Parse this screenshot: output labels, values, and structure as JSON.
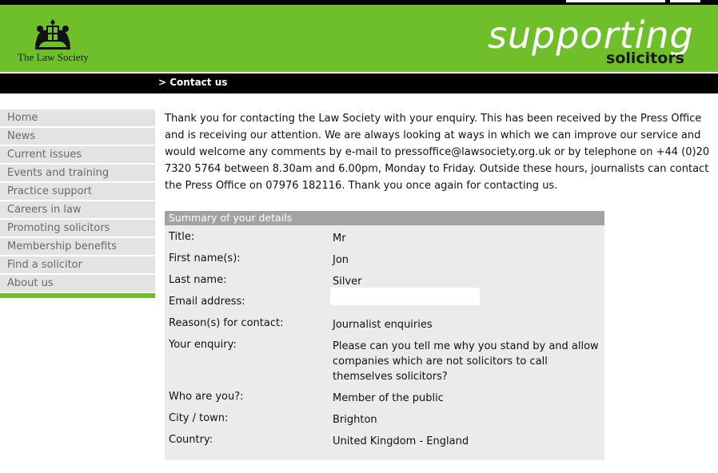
{
  "header": {
    "logo_text": "The Law Society",
    "slogan_top": "supporting",
    "slogan_bottom": "solicitors"
  },
  "breadcrumb": "> Contact us",
  "sidebar": {
    "items": [
      {
        "label": "Home"
      },
      {
        "label": "News"
      },
      {
        "label": "Current issues"
      },
      {
        "label": "Events and training"
      },
      {
        "label": "Practice support"
      },
      {
        "label": "Careers in law"
      },
      {
        "label": "Promoting solicitors"
      },
      {
        "label": "Membership benefits"
      },
      {
        "label": "Find a solicitor"
      },
      {
        "label": "About us"
      }
    ]
  },
  "main": {
    "intro": "Thank you for contacting the Law Society with your enquiry. This has been received by the Press Office and is receiving our attention. We are always looking at ways in which we can improve our service and would welcome any comments by e-mail to pressoffice@lawsociety.org.uk or by telephone on +44 (0)20 7320 5764 between 8.30am and 6.00pm, Monday to Friday. Outside these hours, journalists can contact the Press Office on 07976 182116. Thank you once again for contacting us.",
    "summary": {
      "heading": "Summary of your details",
      "rows": [
        {
          "label": "Title:",
          "value": "Mr"
        },
        {
          "label": "First name(s):",
          "value": "Jon"
        },
        {
          "label": "Last name:",
          "value": "Silver"
        },
        {
          "label": "Email address:",
          "value": ""
        },
        {
          "label": "Reason(s) for contact:",
          "value": "Journalist enquiries"
        },
        {
          "label": "Your enquiry:",
          "value": "Please can you tell me why you stand by and allow companies which are not solicitors to call themselves solicitors?"
        },
        {
          "label": "Who are you?:",
          "value": "Member of the public"
        },
        {
          "label": "City / town:",
          "value": "Brighton"
        },
        {
          "label": "Country:",
          "value": "United Kingdom - England"
        }
      ]
    }
  },
  "colors": {
    "brand_green": "#6ebf2a",
    "nav_bg": "#e3e3e3",
    "summary_bg": "#ebebeb",
    "summary_head": "#a3a3a3"
  }
}
